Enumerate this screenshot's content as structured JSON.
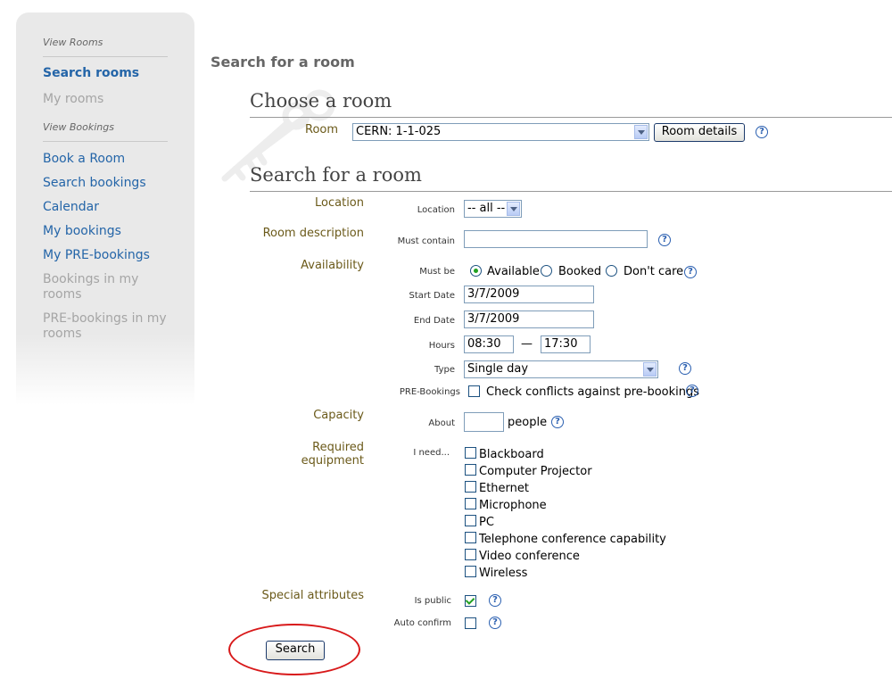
{
  "sidebar": {
    "section_view_rooms": "View Rooms",
    "search_rooms": "Search rooms",
    "my_rooms": "My rooms",
    "section_view_bookings": "View Bookings",
    "book_a_room": "Book a Room",
    "search_bookings": "Search bookings",
    "calendar": "Calendar",
    "my_bookings": "My bookings",
    "my_pre_bookings": "My PRE-bookings",
    "bookings_in_my_rooms": "Bookings in my rooms",
    "pre_bookings_in_my_rooms": "PRE-bookings in my rooms"
  },
  "main": {
    "page_title": "Search for a room",
    "choose_heading": "Choose a room",
    "room_label": "Room",
    "room_value": "CERN:  1-1-025",
    "room_details_button": "Room details",
    "search_heading": "Search for a room"
  },
  "form": {
    "location": {
      "category": "Location",
      "label": "Location",
      "value": "-- all --"
    },
    "room_description": {
      "category": "Room description",
      "label": "Must contain",
      "value": ""
    },
    "availability": {
      "category": "Availability",
      "must_be_label": "Must be",
      "options": [
        "Available",
        "Booked",
        "Don't care"
      ],
      "selected": "Available",
      "start_date_label": "Start Date",
      "start_date": "3/7/2009",
      "end_date_label": "End Date",
      "end_date": "3/7/2009",
      "hours_label": "Hours",
      "hours_from": "08:30",
      "hours_dash": "—",
      "hours_to": "17:30",
      "type_label": "Type",
      "type_value": "Single day",
      "pre_bookings_label": "PRE-Bookings",
      "pre_bookings_text": "Check conflicts against pre-bookings",
      "pre_bookings_checked": false
    },
    "capacity": {
      "category": "Capacity",
      "label": "About",
      "value": "",
      "unit": "people"
    },
    "equipment": {
      "category": "Required equipment",
      "label": "I need...",
      "items": [
        "Blackboard",
        "Computer Projector",
        "Ethernet",
        "Microphone",
        "PC",
        "Telephone conference capability",
        "Video conference",
        "Wireless"
      ]
    },
    "special": {
      "category": "Special attributes",
      "is_public_label": "Is public",
      "is_public_checked": true,
      "auto_confirm_label": "Auto confirm",
      "auto_confirm_checked": false
    },
    "search_button": "Search"
  },
  "icons": {
    "help": "help-icon",
    "dropdown": "chevron-down-icon"
  },
  "colors": {
    "link": "#2465a8",
    "category": "#6b5a1a",
    "annotation": "#d8191a",
    "check": "#21a121"
  }
}
